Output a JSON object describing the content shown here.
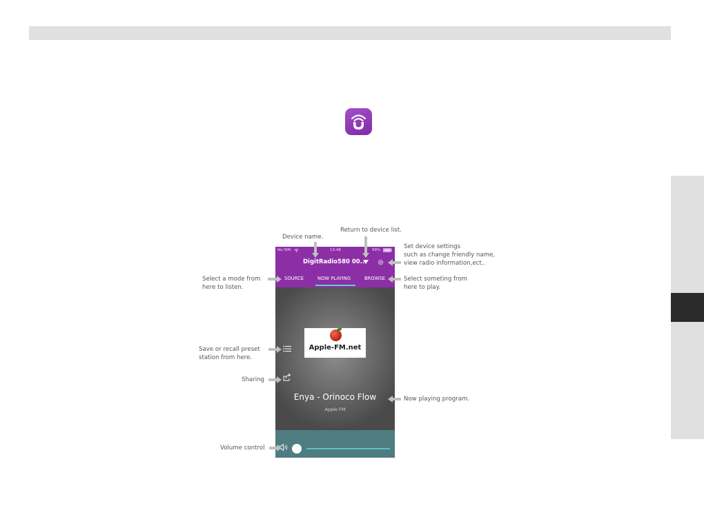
{
  "annotations": {
    "device_name": "Device name.",
    "return_device_list": "Return to device list.",
    "settings_line1": "Set device settings",
    "settings_line2": "such as change friendly name,",
    "settings_line3": "view radio information,ect..",
    "select_mode_line1": "Select a mode from",
    "select_mode_line2": "here to listen.",
    "select_something_line1": "Select someting from",
    "select_something_line2": "here to play.",
    "preset_line1": "Save or recall preset",
    "preset_line2": "station from here.",
    "sharing": "Sharing",
    "now_playing": "Now playing program.",
    "volume": "Volume control"
  },
  "phone": {
    "status": {
      "carrier": "No SIM",
      "time": "13:48",
      "battery": "99%"
    },
    "device_name": "DigitRadio580 00...",
    "tabs": [
      "SOURCE",
      "NOW PLAYING",
      "BROWSE"
    ],
    "active_tab": "NOW PLAYING",
    "station_logo_text": "Apple-FM.net",
    "track_title": "Enya - Orinoco Flow",
    "station_name": "Apple FM",
    "volume_level": 0
  },
  "colors": {
    "header": "#8c2fa6",
    "tab_underline": "#5fd3c6",
    "volume_bar": "#4e7c80",
    "app_icon": "#8c33b5"
  },
  "icons": [
    "app-icon",
    "wifi-icon",
    "battery-icon",
    "caret-down-icon",
    "gear-icon",
    "preset-list-icon",
    "share-icon",
    "speaker-icon"
  ]
}
